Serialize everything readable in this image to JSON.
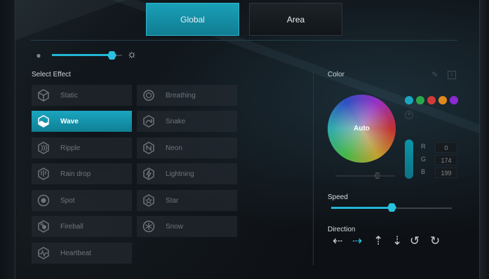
{
  "tabs": {
    "global": "Global",
    "area": "Area"
  },
  "brightness": {
    "level": 0.85
  },
  "effects": {
    "heading": "Select Effect",
    "items": [
      {
        "label": "Static",
        "icon": "cube-icon",
        "active": false
      },
      {
        "label": "Breathing",
        "icon": "breathing-icon",
        "active": false
      },
      {
        "label": "Wave",
        "icon": "wave-icon",
        "active": true
      },
      {
        "label": "Snake",
        "icon": "snake-icon",
        "active": false
      },
      {
        "label": "Ripple",
        "icon": "ripple-icon",
        "active": false
      },
      {
        "label": "Neon",
        "icon": "neon-icon",
        "active": false
      },
      {
        "label": "Rain drop",
        "icon": "rain-drop-icon",
        "active": false
      },
      {
        "label": "Lightning",
        "icon": "lightning-icon",
        "active": false
      },
      {
        "label": "Spot",
        "icon": "spot-icon",
        "active": false
      },
      {
        "label": "Star",
        "icon": "star-icon",
        "active": false
      },
      {
        "label": "Fireball",
        "icon": "fireball-icon",
        "active": false
      },
      {
        "label": "Snow",
        "icon": "snowflake-icon",
        "active": false
      },
      {
        "label": "Heartbeat",
        "icon": "heartbeat-icon",
        "active": false
      }
    ]
  },
  "color": {
    "heading": "Color",
    "wheel_label": "Auto",
    "swatches": [
      "#1aa6c0",
      "#2aa84a",
      "#d23a3a",
      "#e08a1e",
      "#8a2ad0"
    ],
    "rgb": {
      "r_label": "R",
      "g_label": "G",
      "b_label": "B",
      "r": "0",
      "g": "174",
      "b": "199"
    },
    "hue_level": 0.7
  },
  "speed": {
    "label": "Speed",
    "level": 0.5
  },
  "direction": {
    "label": "Direction",
    "options": [
      {
        "icon": "arrow-left-icon",
        "glyph": "⇠",
        "active": false
      },
      {
        "icon": "arrow-right-icon",
        "glyph": "⇢",
        "active": true
      },
      {
        "icon": "arrow-up-icon",
        "glyph": "⇡",
        "active": false
      },
      {
        "icon": "arrow-down-icon",
        "glyph": "⇣",
        "active": false
      },
      {
        "icon": "rotate-ccw-icon",
        "glyph": "↺",
        "active": false
      },
      {
        "icon": "rotate-cw-icon",
        "glyph": "↻",
        "active": false
      }
    ]
  },
  "colors": {
    "accent": "#1aa6c0",
    "active_tab": "#1497ad"
  }
}
